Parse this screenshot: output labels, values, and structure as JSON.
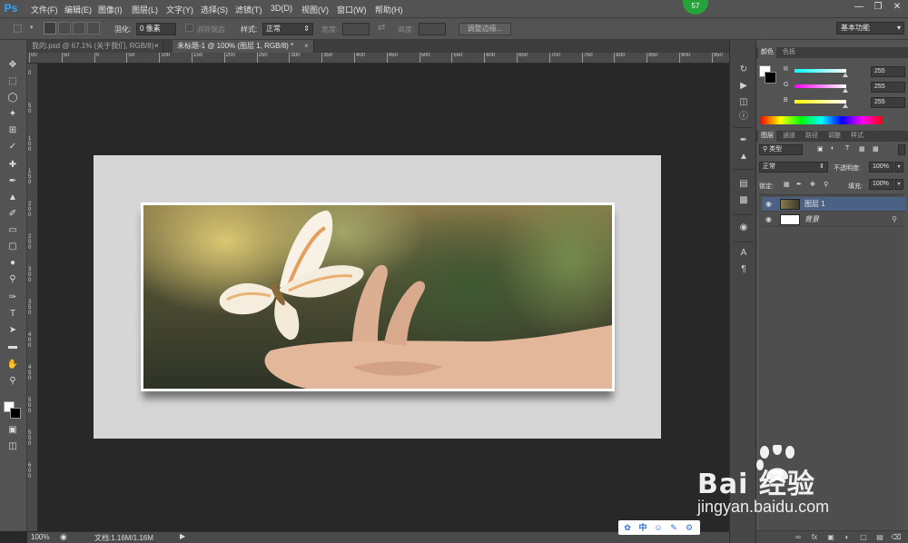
{
  "app": {
    "logo": "Ps"
  },
  "menu": [
    "文件(F)",
    "编辑(E)",
    "图像(I)",
    "图层(L)",
    "文字(Y)",
    "选择(S)",
    "滤镜(T)",
    "3D(D)",
    "视图(V)",
    "窗口(W)",
    "帮助(H)"
  ],
  "user_badge": "57",
  "options": {
    "feather_label": "羽化:",
    "feather_value": "0 像素",
    "antialias_label": "消除锯齿",
    "style_label": "样式:",
    "style_value": "正常",
    "width_label": "宽度:",
    "height_label": "高度:",
    "refine_edge_button": "调整边缘..."
  },
  "workspace_preset": "基本功能",
  "tabs": [
    {
      "label": "我的.psd @ 67.1% (关于我们, RGB/8)",
      "active": false
    },
    {
      "label": "未标题-1 @ 100% (图层 1, RGB/8) *",
      "active": true
    }
  ],
  "ruler_top": [
    "00",
    "50",
    "0",
    "50",
    "100",
    "150",
    "200",
    "250",
    "300",
    "350",
    "400",
    "450",
    "500",
    "550",
    "600",
    "650",
    "700",
    "750",
    "800",
    "850",
    "900",
    "950"
  ],
  "ruler_left": [
    "0",
    "50",
    "100",
    "150",
    "200",
    "250",
    "300",
    "350",
    "400",
    "450",
    "500",
    "550",
    "600"
  ],
  "status": {
    "zoom": "100%",
    "doc": "文档:1.16M/1.16M"
  },
  "color_panel": {
    "tabs": [
      "颜色",
      "色板"
    ],
    "channels": [
      {
        "name": "R",
        "value": "255"
      },
      {
        "name": "G",
        "value": "255"
      },
      {
        "name": "B",
        "value": "255"
      }
    ]
  },
  "layers_panel": {
    "tabs": [
      "图层",
      "通道",
      "路径",
      "调整",
      "样式"
    ],
    "kind_filter": "类型",
    "blend_mode": "正常",
    "opacity_label": "不透明度:",
    "opacity_value": "100%",
    "lock_label": "锁定:",
    "fill_label": "填充:",
    "fill_value": "100%",
    "layers": [
      {
        "name": "图层 1",
        "selected": true
      },
      {
        "name": "背景",
        "selected": false,
        "locked": true
      }
    ]
  },
  "watermark": {
    "brand": "Bai  经验",
    "url": "jingyan.baidu.com"
  },
  "float_toolbar": [
    "中"
  ]
}
